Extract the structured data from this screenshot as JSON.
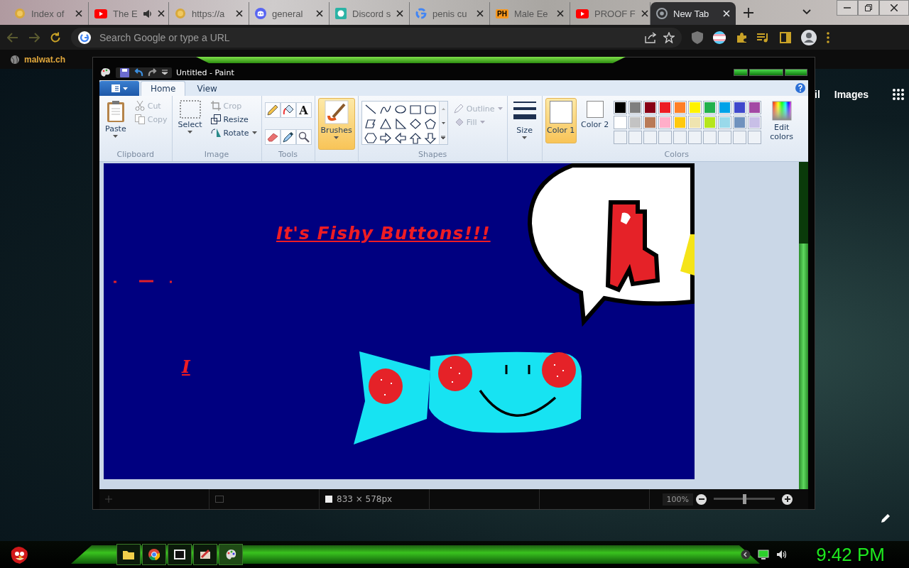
{
  "browser": {
    "tabs": [
      {
        "title": "Index of",
        "kind": "site",
        "audio": false,
        "selected": false
      },
      {
        "title": "The E",
        "kind": "video",
        "audio": true,
        "selected": false
      },
      {
        "title": "https://a",
        "kind": "site",
        "audio": false,
        "selected": false
      },
      {
        "title": "general",
        "kind": "chat",
        "audio": false,
        "selected": false
      },
      {
        "title": "Discord s",
        "kind": "bot",
        "audio": false,
        "selected": false
      },
      {
        "title": "penis cu",
        "kind": "search",
        "audio": false,
        "selected": false
      },
      {
        "title": "Male Ee",
        "kind": "badge",
        "badge": "PH",
        "audio": false,
        "selected": false
      },
      {
        "title": "PROOF F",
        "kind": "video",
        "audio": false,
        "selected": false
      },
      {
        "title": "New Tab",
        "kind": "newtab",
        "audio": false,
        "selected": true
      }
    ],
    "address": {
      "placeholder": "Search Google or type a URL"
    },
    "bookmarks": [
      {
        "label": "malwat.ch"
      }
    ],
    "page_links": [
      "il",
      "Images"
    ]
  },
  "paint": {
    "title": "Untitled - Paint",
    "ribbon_tabs": [
      {
        "label": "Home",
        "selected": true
      },
      {
        "label": "View",
        "selected": false
      }
    ],
    "clipboard": {
      "paste": "Paste",
      "cut": {
        "label": "Cut",
        "disabled": true
      },
      "copy": {
        "label": "Copy",
        "disabled": true
      },
      "group": "Clipboard"
    },
    "image": {
      "select": "Select",
      "crop": {
        "label": "Crop",
        "disabled": true
      },
      "resize": {
        "label": "Resize",
        "disabled": false
      },
      "rotate": {
        "label": "Rotate",
        "disabled": false
      },
      "group": "Image"
    },
    "tools": {
      "text_glyph": "A",
      "group": "Tools"
    },
    "brushes": {
      "label": "Brushes",
      "selected": true
    },
    "shapes": {
      "outline": {
        "label": "Outline",
        "disabled": true
      },
      "fill": {
        "label": "Fill",
        "disabled": true
      },
      "group": "Shapes"
    },
    "size": {
      "label": "Size"
    },
    "colors": {
      "color1": {
        "label": "Color 1",
        "color": "#ffffff",
        "selected": true
      },
      "color2": {
        "label": "Color 2",
        "color": "#ffffff",
        "selected": false
      },
      "palette": [
        {
          "color": "#000000"
        },
        {
          "color": "#7f7f7f"
        },
        {
          "color": "#880015"
        },
        {
          "color": "#ed1c24"
        },
        {
          "color": "#ff7f27"
        },
        {
          "color": "#fff200"
        },
        {
          "color": "#22b14c"
        },
        {
          "color": "#00a2e8"
        },
        {
          "color": "#3f48cc"
        },
        {
          "color": "#a349a4"
        },
        {
          "color": "#ffffff"
        },
        {
          "color": "#c3c3c3"
        },
        {
          "color": "#b97a57"
        },
        {
          "color": "#ffaec9"
        },
        {
          "color": "#ffc90e"
        },
        {
          "color": "#efe4b0"
        },
        {
          "color": "#b5e61d"
        },
        {
          "color": "#99d9ea"
        },
        {
          "color": "#7092be"
        },
        {
          "color": "#c8bfe7"
        }
      ],
      "edit": "Edit colors",
      "group": "Colors"
    },
    "canvas": {
      "heading": "It's Fishy Buttons!!!",
      "letter": "I"
    },
    "status": {
      "dimensions": "833 × 578px",
      "zoom": "100%",
      "zoom_slider": {
        "level": 0.5
      }
    }
  },
  "taskbar": {
    "clock": "9:42 PM"
  }
}
